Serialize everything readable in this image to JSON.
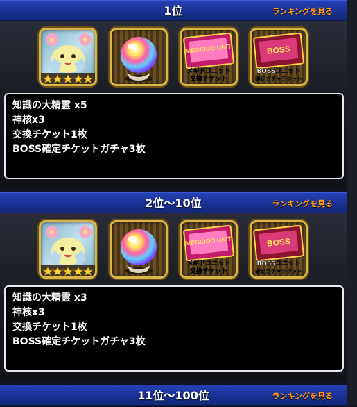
{
  "ranks": [
    {
      "title": "1位",
      "link": "ランキングを見る",
      "rewards": [
        {
          "icon": "spirit-character-icon",
          "stars": 5
        },
        {
          "icon": "rainbow-orb-icon"
        },
        {
          "icon": "megiddo-unit-ticket-icon",
          "logo": "MEGIDDO UNIT",
          "caption1": "メギドユニット",
          "caption2": "交換チケット"
        },
        {
          "icon": "boss-unit-ticket-icon",
          "logo": "BOSS",
          "caption1": "BOSSユニット",
          "caption2": "確定ガチャチケット"
        }
      ],
      "lines": [
        "知識の大精霊 x5",
        "神核x3",
        "交換チケット1枚",
        "BOSS確定チケットガチャ3枚"
      ]
    },
    {
      "title": "2位〜10位",
      "link": "ランキングを見る",
      "rewards": [
        {
          "icon": "spirit-character-icon",
          "stars": 5
        },
        {
          "icon": "rainbow-orb-icon"
        },
        {
          "icon": "megiddo-unit-ticket-icon",
          "logo": "MEGIDDO UNIT",
          "caption1": "メギドユニット",
          "caption2": "交換チケット"
        },
        {
          "icon": "boss-unit-ticket-icon",
          "logo": "BOSS",
          "caption1": "BOSSユニット",
          "caption2": "確定ガチャチケット"
        }
      ],
      "lines": [
        "知識の大精霊 x3",
        "神核x3",
        "交換チケット1枚",
        "BOSS確定チケットガチャ3枚"
      ]
    },
    {
      "title": "11位〜100位",
      "link": "ランキングを見る"
    }
  ],
  "colors": {
    "accent_link": "#ff9a1c",
    "header_blue": "#1d36a3",
    "frame_gold": "#d8b64a"
  }
}
